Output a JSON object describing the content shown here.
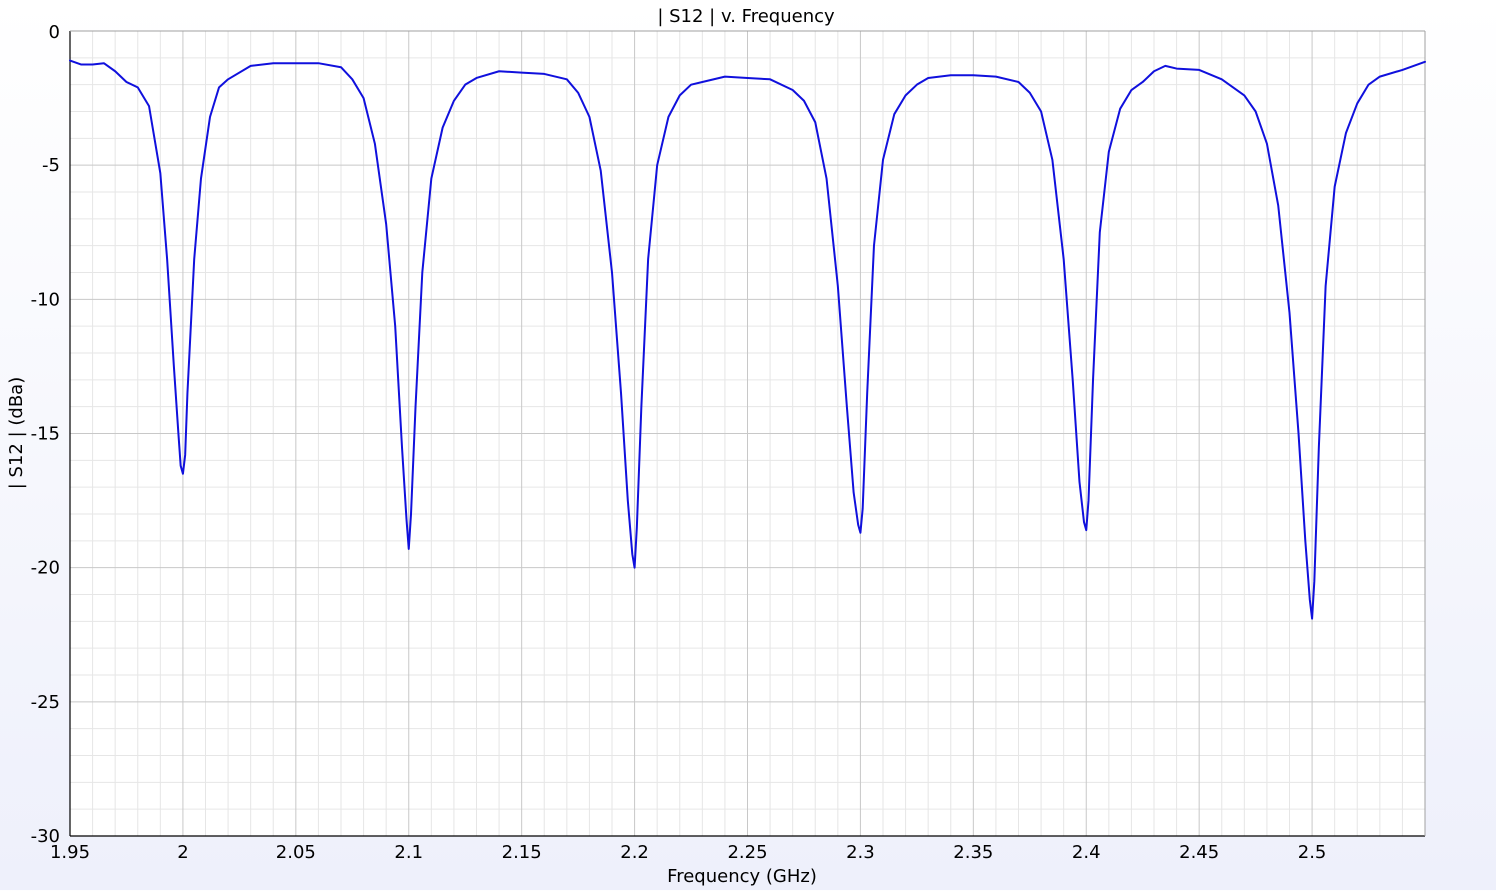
{
  "chart_data": {
    "type": "line",
    "title": "| S12 | v. Frequency",
    "xlabel": "Frequency (GHz)",
    "ylabel": "| S12 | (dBa)",
    "xlim": [
      1.95,
      2.55
    ],
    "ylim": [
      -30,
      0
    ],
    "xticks": [
      1.95,
      2.0,
      2.05,
      2.1,
      2.15,
      2.2,
      2.25,
      2.3,
      2.35,
      2.4,
      2.45,
      2.5
    ],
    "xtick_labels": [
      "1.95",
      "2",
      "2.05",
      "2.1",
      "2.15",
      "2.2",
      "2.25",
      "2.3",
      "2.35",
      "2.4",
      "2.45",
      "2.5"
    ],
    "yticks": [
      0,
      -5,
      -10,
      -15,
      -20,
      -25,
      -30
    ],
    "ytick_labels": [
      "0",
      "-5",
      "-10",
      "-15",
      "-20",
      "-25",
      "-30"
    ],
    "grid": true,
    "minor_grid": true,
    "legend": "none",
    "colors": {
      "line": "#1010dd",
      "major_grid": "#c8c8c8",
      "minor_grid": "#e6e6e6",
      "axes": "#000000"
    },
    "series": [
      {
        "x": [
          1.95,
          1.955,
          1.96,
          1.965,
          1.97,
          1.975,
          1.98,
          1.985,
          1.99,
          1.993,
          1.996,
          1.998,
          1.999,
          2.0,
          2.001,
          2.002,
          2.005,
          2.008,
          2.012,
          2.016,
          2.02,
          2.03,
          2.04,
          2.05,
          2.06,
          2.07,
          2.075,
          2.08,
          2.085,
          2.09,
          2.094,
          2.097,
          2.099,
          2.1,
          2.101,
          2.103,
          2.106,
          2.11,
          2.115,
          2.12,
          2.125,
          2.13,
          2.14,
          2.15,
          2.16,
          2.17,
          2.175,
          2.18,
          2.185,
          2.19,
          2.194,
          2.197,
          2.199,
          2.2,
          2.201,
          2.203,
          2.206,
          2.21,
          2.215,
          2.22,
          2.225,
          2.23,
          2.24,
          2.25,
          2.26,
          2.27,
          2.275,
          2.28,
          2.285,
          2.29,
          2.294,
          2.297,
          2.299,
          2.3,
          2.301,
          2.303,
          2.306,
          2.31,
          2.315,
          2.32,
          2.325,
          2.33,
          2.34,
          2.35,
          2.36,
          2.37,
          2.375,
          2.38,
          2.385,
          2.39,
          2.394,
          2.397,
          2.399,
          2.4,
          2.401,
          2.403,
          2.406,
          2.41,
          2.415,
          2.42,
          2.425,
          2.43,
          2.435,
          2.44,
          2.45,
          2.46,
          2.47,
          2.475,
          2.48,
          2.485,
          2.49,
          2.494,
          2.497,
          2.499,
          2.5,
          2.501,
          2.503,
          2.506,
          2.51,
          2.515,
          2.52,
          2.525,
          2.53,
          2.54,
          2.55
        ],
        "y": [
          -1.1,
          -1.25,
          -1.25,
          -1.2,
          -1.5,
          -1.9,
          -2.1,
          -2.8,
          -5.3,
          -8.5,
          -12.5,
          -15.0,
          -16.2,
          -16.5,
          -15.8,
          -13.5,
          -8.5,
          -5.5,
          -3.2,
          -2.1,
          -1.8,
          -1.3,
          -1.2,
          -1.2,
          -1.2,
          -1.35,
          -1.8,
          -2.5,
          -4.2,
          -7.2,
          -11.0,
          -15.5,
          -18.2,
          -19.3,
          -18.0,
          -14.0,
          -9.0,
          -5.5,
          -3.6,
          -2.6,
          -2.0,
          -1.75,
          -1.5,
          -1.55,
          -1.6,
          -1.8,
          -2.3,
          -3.2,
          -5.2,
          -9.0,
          -13.5,
          -17.5,
          -19.5,
          -20.0,
          -18.5,
          -14.0,
          -8.5,
          -5.0,
          -3.2,
          -2.4,
          -2.0,
          -1.9,
          -1.7,
          -1.75,
          -1.8,
          -2.2,
          -2.6,
          -3.4,
          -5.5,
          -9.5,
          -14.0,
          -17.2,
          -18.4,
          -18.7,
          -17.8,
          -13.5,
          -8.0,
          -4.8,
          -3.1,
          -2.4,
          -2.0,
          -1.75,
          -1.65,
          -1.65,
          -1.7,
          -1.9,
          -2.3,
          -3.0,
          -4.8,
          -8.5,
          -13.0,
          -16.8,
          -18.3,
          -18.6,
          -17.5,
          -13.0,
          -7.5,
          -4.5,
          -2.9,
          -2.2,
          -1.9,
          -1.5,
          -1.3,
          -1.4,
          -1.45,
          -1.8,
          -2.4,
          -3.0,
          -4.2,
          -6.5,
          -10.5,
          -15.0,
          -19.0,
          -21.2,
          -21.9,
          -20.5,
          -15.5,
          -9.5,
          -5.8,
          -3.8,
          -2.7,
          -2.0,
          -1.7,
          -1.45,
          -1.15
        ]
      }
    ]
  }
}
